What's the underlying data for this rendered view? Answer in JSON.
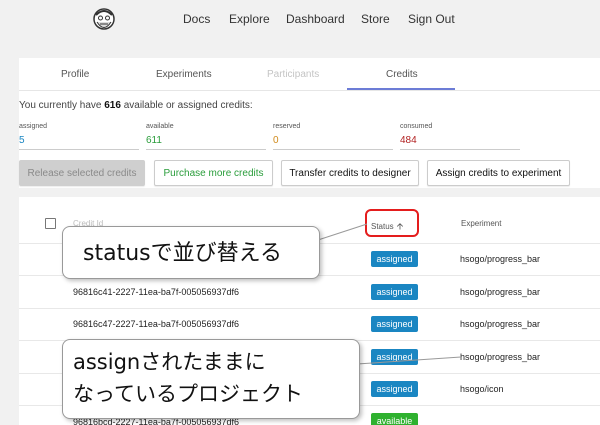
{
  "nav": {
    "items": [
      "Docs",
      "Explore",
      "Dashboard",
      "Store",
      "Sign Out"
    ]
  },
  "tabs": [
    {
      "label": "Profile",
      "state": "normal"
    },
    {
      "label": "Experiments",
      "state": "normal"
    },
    {
      "label": "Participants",
      "state": "disabled"
    },
    {
      "label": "Credits",
      "state": "active"
    }
  ],
  "credits": {
    "summary_prefix": "You currently have ",
    "summary_count": "616",
    "summary_suffix": " available or assigned credits:",
    "stats": [
      {
        "label": "assigned",
        "value": "5",
        "color": "#1a86c2"
      },
      {
        "label": "available",
        "value": "611",
        "color": "#2a9d3b"
      },
      {
        "label": "reserved",
        "value": "0",
        "color": "#d08a1a"
      },
      {
        "label": "consumed",
        "value": "484",
        "color": "#b22222"
      }
    ]
  },
  "actions": {
    "release": "Release selected credits",
    "purchase": "Purchase more credits",
    "transfer": "Transfer credits to designer",
    "assign": "Assign credits to experiment"
  },
  "table": {
    "headers": {
      "credit_id": "Credit Id",
      "status": "Status",
      "experiment": "Experiment"
    },
    "rows": [
      {
        "id": "",
        "status": "assigned",
        "experiment": "hsogo/progress_bar"
      },
      {
        "id": "96816c41-2227-11ea-ba7f-005056937df6",
        "status": "assigned",
        "experiment": "hsogo/progress_bar"
      },
      {
        "id": "96816c47-2227-11ea-ba7f-005056937df6",
        "status": "assigned",
        "experiment": "hsogo/progress_bar"
      },
      {
        "id": "",
        "status": "assigned",
        "experiment": "hsogo/progress_bar"
      },
      {
        "id": "",
        "status": "assigned",
        "experiment": "hsogo/icon"
      },
      {
        "id": "96816bcd-2227-11ea-ba7f-005056937df6",
        "status": "available",
        "experiment": ""
      }
    ]
  },
  "annotations": {
    "sort_note": "statusで並び替える",
    "assigned_note_line1": "assignされたままに",
    "assigned_note_line2": "なっているプロジェクト"
  }
}
